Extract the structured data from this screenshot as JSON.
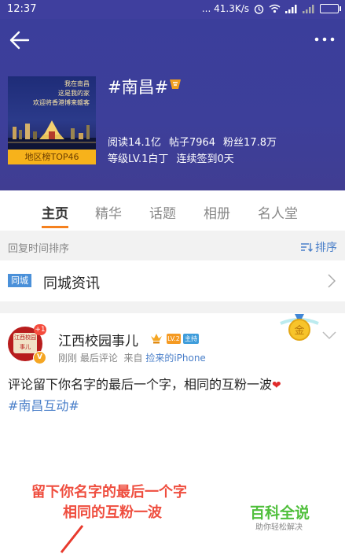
{
  "status_bar": {
    "time": "12:37",
    "network_speed": "... 41.3K/s"
  },
  "header": {
    "cover_text": [
      "我在南昌",
      "这是我的家",
      "欢迎将香港博来赣客"
    ],
    "cover_rank": "地区榜TOP46",
    "title": "#南昌#",
    "stats_row1": [
      "阅读14.1亿",
      "帖子7964",
      "粉丝17.8万"
    ],
    "stats_row2": [
      "等级LV.1白丁",
      "连续签到0天"
    ]
  },
  "tabs": [
    {
      "label": "主页",
      "active": true
    },
    {
      "label": "精华",
      "active": false
    },
    {
      "label": "话题",
      "active": false
    },
    {
      "label": "相册",
      "active": false
    },
    {
      "label": "名人堂",
      "active": false
    }
  ],
  "sort_bar": {
    "label": "回复时间排序",
    "sort_button": "排序"
  },
  "city_row": {
    "tag": "同城",
    "text": "同城资讯"
  },
  "post": {
    "avatar_text": "江西校园事儿",
    "avatar_plus": "+1",
    "avatar_v": "V",
    "author": "江西校园事儿",
    "badge_lv": "LV.2",
    "badge_blue": "主持",
    "meta_time": "刚刚 最后评论",
    "meta_from": "来自",
    "meta_source": "捡来的iPhone",
    "medal_text": "金",
    "text": "评论留下你名字的最后一个字，相同的互粉一波",
    "hashtag": "#南昌互动#",
    "image_line1": "留下你名字的最后一个字",
    "image_line2": "相同的互粉一波",
    "watermark_title": "百科全说",
    "watermark_sub": "助你轻松解决"
  },
  "colors": {
    "header_bg": "#3d3f9a",
    "accent_orange": "#f5811f",
    "link_blue": "#4a7fc9",
    "image_red": "#ef4e3f",
    "watermark_green": "#4fbf3b"
  }
}
